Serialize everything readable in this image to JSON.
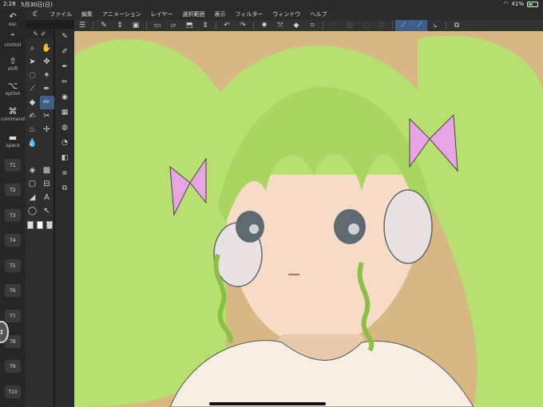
{
  "status": {
    "time": "2:28",
    "date": "5月30日(日)",
    "battery": "41%",
    "dots": "..."
  },
  "menu": {
    "items": [
      "ファイル",
      "編集",
      "アニメーション",
      "レイヤー",
      "選択範囲",
      "表示",
      "フィルター",
      "ウィンドウ",
      "ヘルプ"
    ]
  },
  "edge": {
    "esc": "esc",
    "control": "control",
    "shift": "shift",
    "option": "option",
    "command": "command",
    "space": "space",
    "keys": [
      "T1",
      "T2",
      "T3",
      "T4",
      "T5",
      "T6",
      "T7",
      "T8",
      "T9",
      "T10"
    ]
  },
  "tools": {
    "text_tool": "A"
  },
  "colors": {
    "main": "#f3d9c5",
    "sub": "#ffffff",
    "transparent": "transparent",
    "accent": "#3d5f8a",
    "canvas_bg": "#d7b783",
    "hair": "#b7e070"
  }
}
